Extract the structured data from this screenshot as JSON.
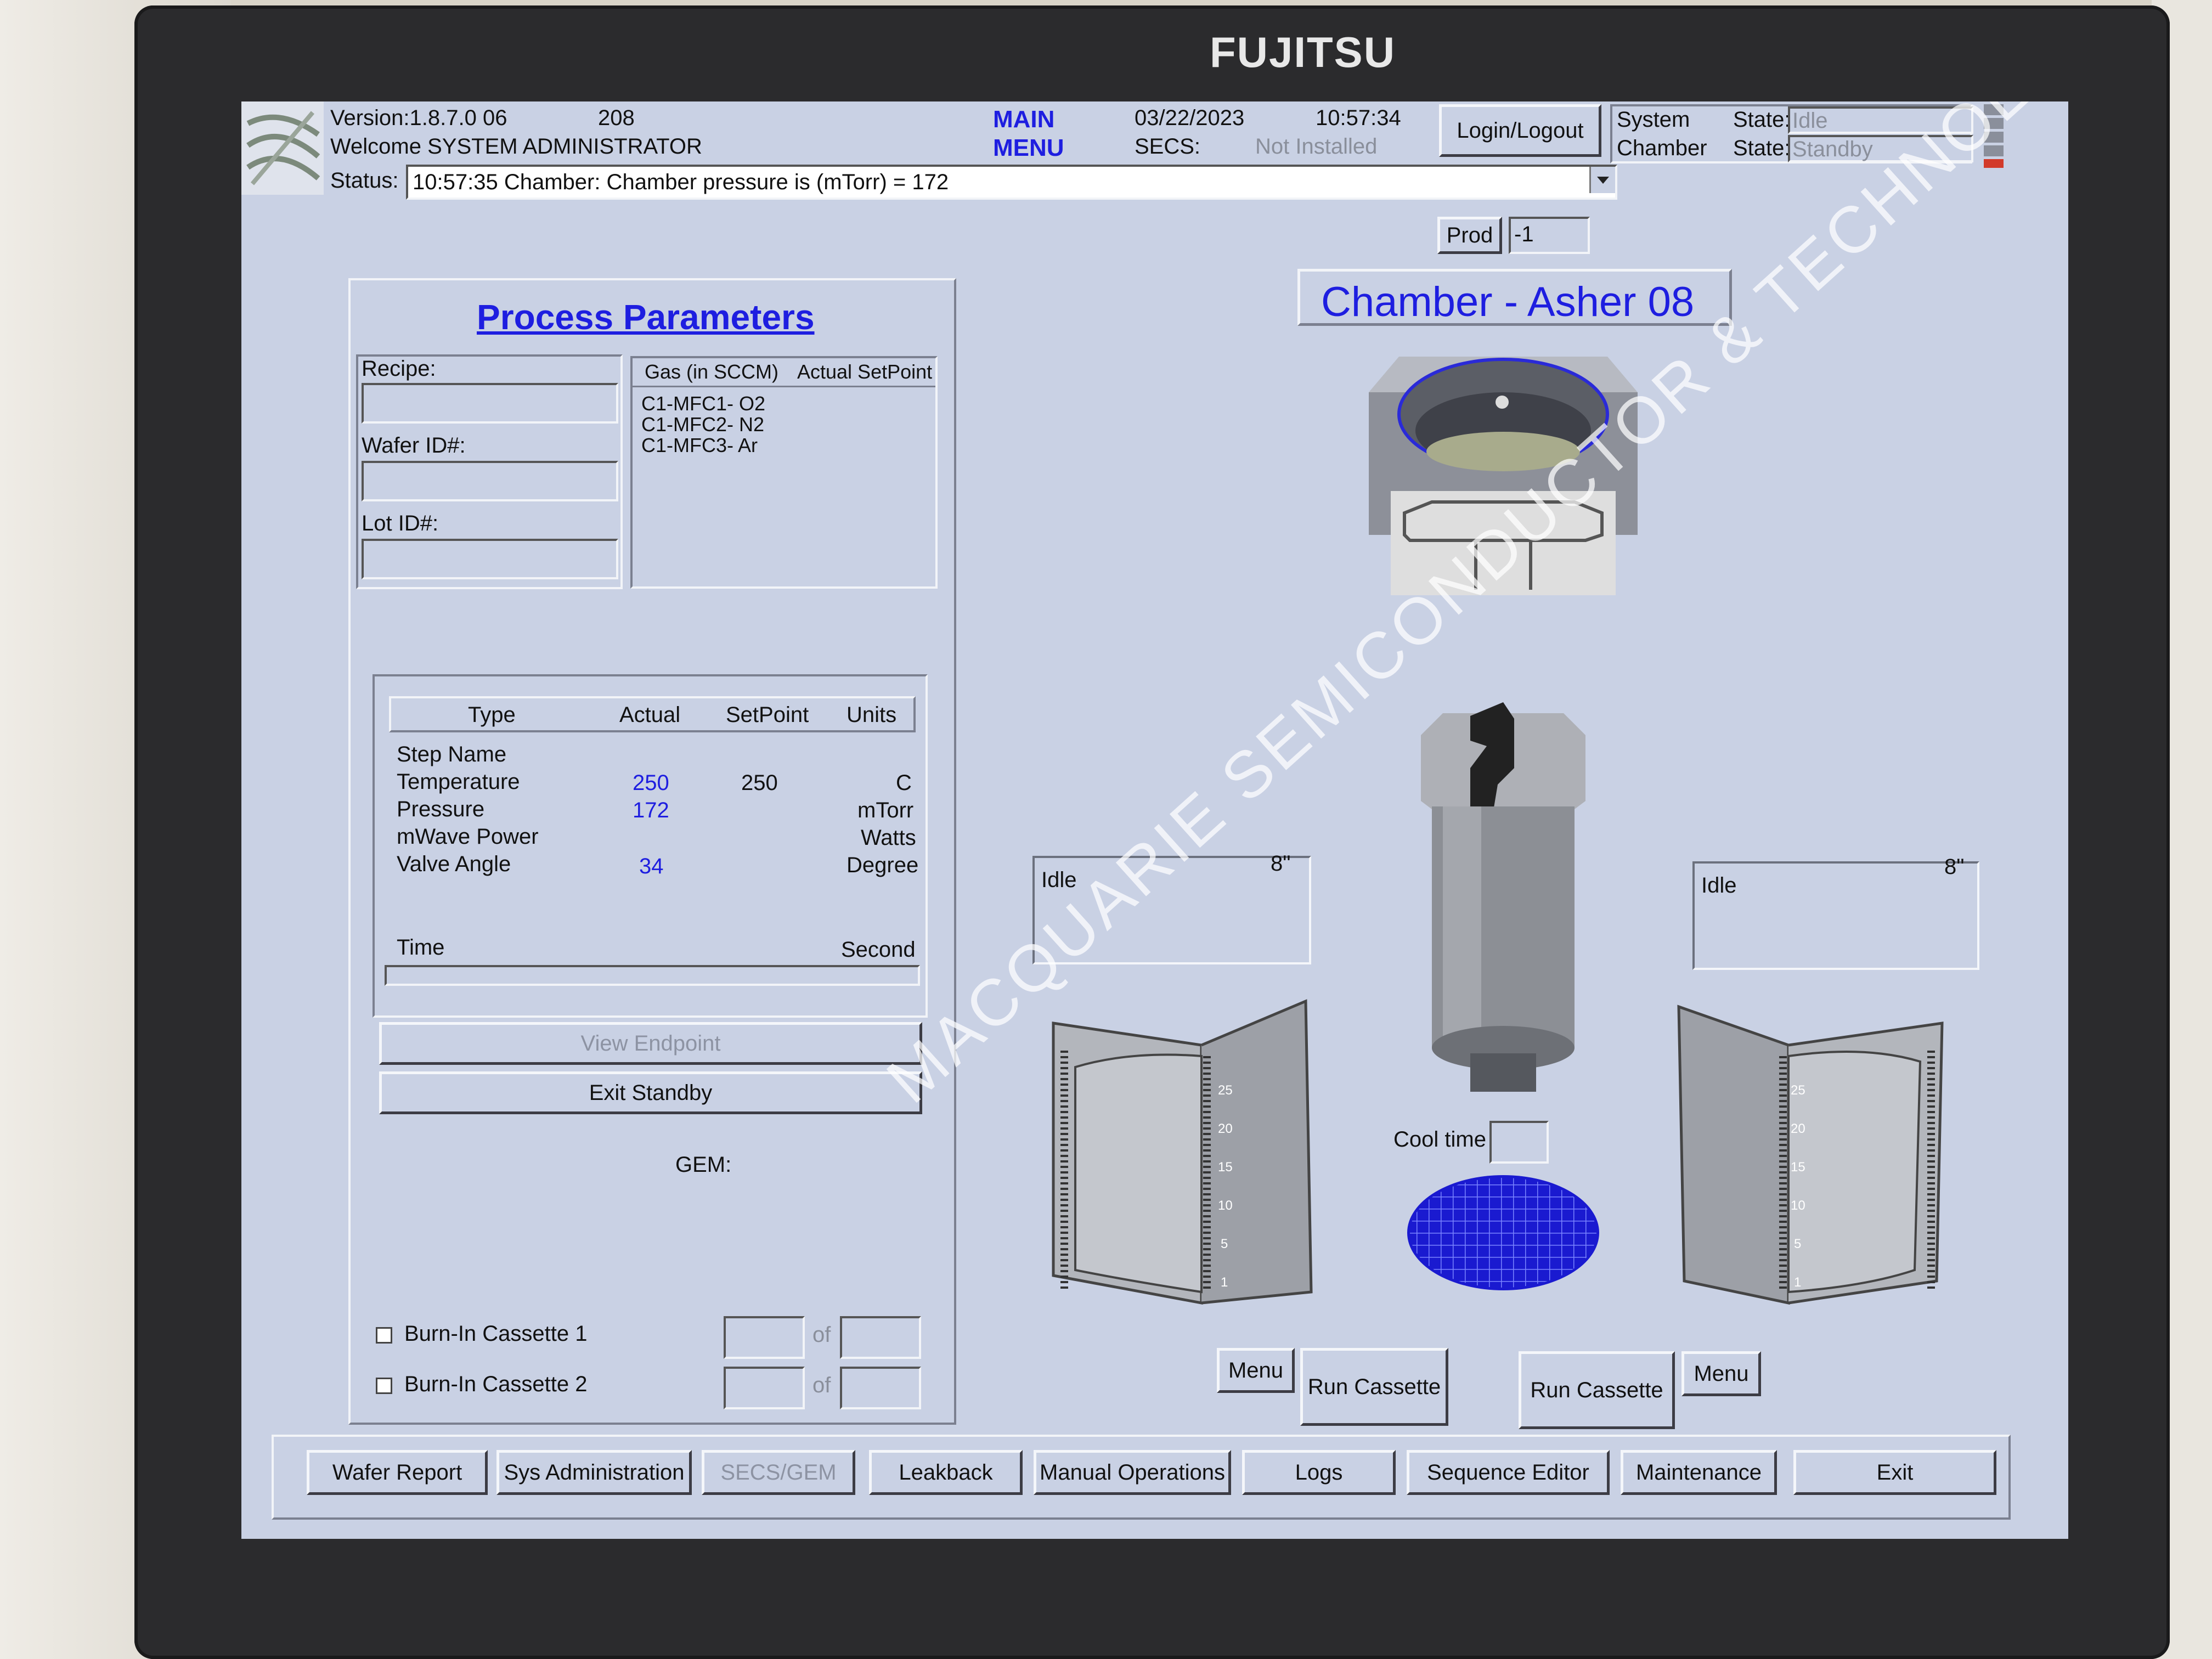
{
  "monitor": {
    "brand": "FUJITSU"
  },
  "header": {
    "version": "Version:1.8.7.0 06",
    "version_num": "208",
    "welcome": "Welcome SYSTEM ADMINISTRATOR",
    "status_label": "Status:",
    "status_value": "10:57:35 Chamber: Chamber pressure is (mTorr) = 172",
    "main_menu_line1": "MAIN",
    "main_menu_line2": "MENU",
    "date": "03/22/2023",
    "time": "10:57:34",
    "secs_label": "SECS:",
    "secs_value": "Not Installed",
    "login_label": "Login/Logout",
    "system_label": "System",
    "system_state_label": "State:",
    "system_state_value": "Idle",
    "chamber_label": "Chamber",
    "chamber_state_label": "State:",
    "chamber_state_value": "Standby"
  },
  "prod": {
    "label": "Prod",
    "value": "-1"
  },
  "chamber_title": "Chamber - Asher 08",
  "process": {
    "title": "Process Parameters",
    "recipe_label": "Recipe:",
    "recipe_value": "",
    "wafer_label": "Wafer ID#:",
    "wafer_value": "",
    "lot_label": "Lot ID#:",
    "lot_value": "",
    "gas_header_left": "Gas (in SCCM)",
    "gas_header_right": "Actual SetPoint",
    "gases": [
      "C1-MFC1- O2",
      "C1-MFC2- N2",
      "C1-MFC3- Ar"
    ],
    "table_headers": {
      "type": "Type",
      "actual": "Actual",
      "setpoint": "SetPoint",
      "units": "Units"
    },
    "rows": [
      {
        "type": "Step Name",
        "actual": "",
        "setpoint": "",
        "units": ""
      },
      {
        "type": "Temperature",
        "actual": "250",
        "setpoint": "250",
        "units": "C"
      },
      {
        "type": "Pressure",
        "actual": "172",
        "setpoint": "",
        "units": "mTorr"
      },
      {
        "type": "mWave Power",
        "actual": "",
        "setpoint": "",
        "units": "Watts"
      },
      {
        "type": "Valve Angle",
        "actual": "34",
        "setpoint": "",
        "units": "Degree"
      }
    ],
    "time_label": "Time",
    "time_units": "Second",
    "view_endpoint": "View Endpoint",
    "exit_standby": "Exit Standby",
    "gem_label": "GEM:",
    "burn1_label": "Burn-In Cassette 1",
    "burn2_label": "Burn-In Cassette 2",
    "of_label": "of"
  },
  "left_station": {
    "status": "Idle",
    "size": "8\"",
    "menu": "Menu",
    "run": "Run Cassette"
  },
  "right_station": {
    "status": "Idle",
    "size": "8\"",
    "menu": "Menu",
    "run": "Run Cassette"
  },
  "cool_time_label": "Cool time",
  "cassette_scale": [
    "25",
    "20",
    "15",
    "10",
    "5",
    "1"
  ],
  "bottom_nav": [
    "Wafer Report",
    "Sys Administration",
    "SECS/GEM",
    "Leakback",
    "Manual Operations",
    "Logs",
    "Sequence Editor",
    "Maintenance",
    "Exit"
  ],
  "watermark": "MACQUARIE SEMICONDUCTOR & TECHNOLOGY",
  "colors": {
    "screen_bg": "#c9d1e4",
    "accent_blue": "#1e1ee0",
    "status_indicator": "#d23a2a"
  }
}
